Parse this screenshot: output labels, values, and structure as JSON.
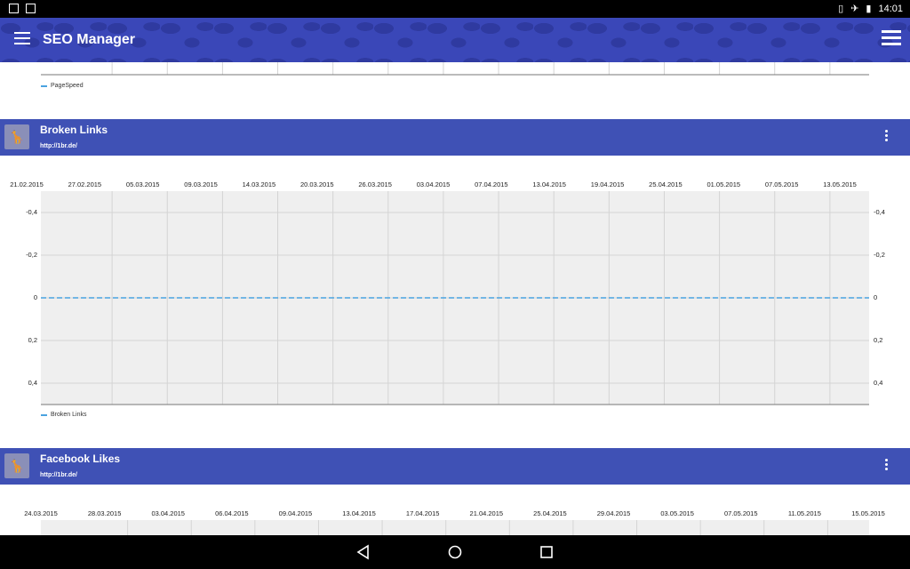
{
  "statusbar": {
    "time": "14:01"
  },
  "appbar": {
    "title": "SEO Manager"
  },
  "pagespeed_card": {
    "legend": "PageSpeed"
  },
  "broken_links_card": {
    "title": "Broken Links",
    "url": "http://1br.de/",
    "legend": "Broken Links"
  },
  "facebook_card": {
    "title": "Facebook Likes",
    "url": "http://1br.de/"
  },
  "chart_data": [
    {
      "type": "line",
      "title": "Broken Links",
      "categories": [
        "21.02.2015",
        "27.02.2015",
        "05.03.2015",
        "09.03.2015",
        "14.03.2015",
        "20.03.2015",
        "26.03.2015",
        "03.04.2015",
        "07.04.2015",
        "13.04.2015",
        "19.04.2015",
        "25.04.2015",
        "01.05.2015",
        "07.05.2015",
        "13.05.2015"
      ],
      "series": [
        {
          "name": "Broken Links",
          "values": [
            0,
            0,
            0,
            0,
            0,
            0,
            0,
            0,
            0,
            0,
            0,
            0,
            0,
            0,
            0
          ]
        }
      ],
      "yticks": [
        "-0,4",
        "-0,2",
        "0",
        "0,2",
        "0,4"
      ],
      "ylim": [
        -0.5,
        0.5
      ],
      "grid": true,
      "legend": "bottom-left"
    },
    {
      "type": "line",
      "title": "Facebook Likes",
      "categories": [
        "24.03.2015",
        "28.03.2015",
        "03.04.2015",
        "06.04.2015",
        "09.04.2015",
        "13.04.2015",
        "17.04.2015",
        "21.04.2015",
        "25.04.2015",
        "29.04.2015",
        "03.05.2015",
        "07.05.2015",
        "11.05.2015",
        "15.05.2015"
      ],
      "series": [],
      "grid": true
    }
  ],
  "colors": {
    "accent": "#3f51b5",
    "series": "#4aa3e0",
    "plot_bg": "#efefef"
  },
  "icons": {
    "nav_menu": "hamburger-icon",
    "overflow": "overflow-menu-icon",
    "back": "back-icon",
    "home": "home-icon",
    "recents": "recents-icon"
  }
}
